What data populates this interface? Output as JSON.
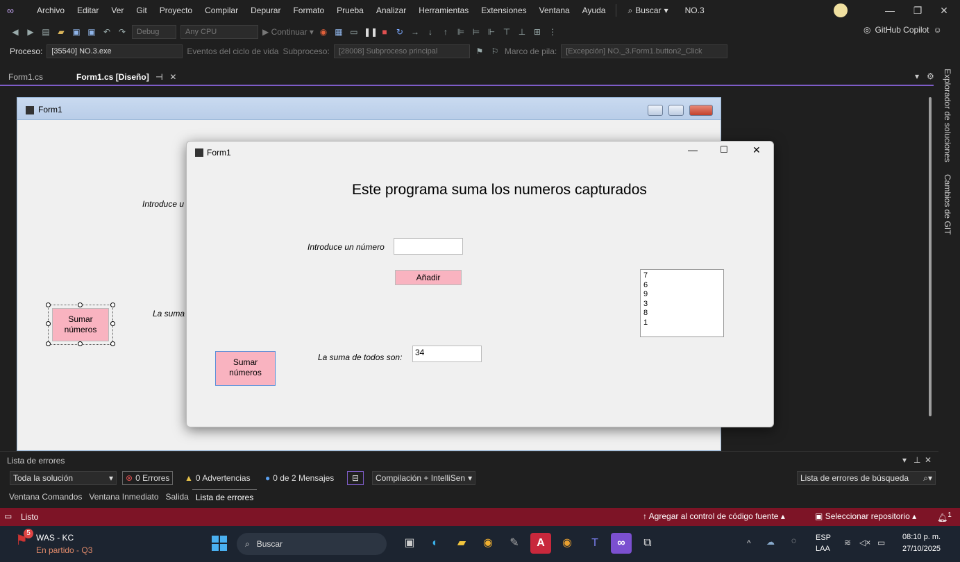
{
  "menubar": {
    "items": [
      "Archivo",
      "Editar",
      "Ver",
      "Git",
      "Proyecto",
      "Compilar",
      "Depurar",
      "Formato",
      "Prueba",
      "Analizar",
      "Herramientas",
      "Extensiones",
      "Ventana",
      "Ayuda"
    ],
    "search_label": "Buscar",
    "solution_name": "NO.3"
  },
  "toolbar": {
    "config": "Debug",
    "platform": "Any CPU",
    "continue_label": "Continuar",
    "copilot_label": "GitHub Copilot"
  },
  "procbar": {
    "process_label": "Proceso:",
    "process_value": "[35540] NO.3.exe",
    "lifecycle_label": "Eventos del ciclo de vida",
    "thread_label": "Subproceso:",
    "thread_value": "[28008] Subproceso principal",
    "stack_label": "Marco de pila:",
    "stack_value": "[Excepción] NO._3.Form1.button2_Click"
  },
  "tabs": [
    {
      "label": "Form1.cs",
      "active": false
    },
    {
      "label": "Form1.cs [Diseño]",
      "active": true
    }
  ],
  "side_tabs": [
    "Explorador de soluciones",
    "Cambios de GIT"
  ],
  "design_form": {
    "title": "Form1",
    "label_intro": "Introduce u",
    "label_sum": "La suma",
    "button_sum": "Sumar números"
  },
  "runtime_form": {
    "title": "Form1",
    "heading": "Este programa suma los numeros capturados",
    "label_intro": "Introduce un número",
    "input_value": "",
    "button_add": "Añadir",
    "label_sum": "La suma de todos son:",
    "sum_value": "34",
    "button_sum": "Sumar números",
    "list_items": [
      "7",
      "6",
      "9",
      "3",
      "8",
      "1"
    ]
  },
  "errlist": {
    "title": "Lista de errores",
    "scope": "Toda la solución",
    "errors": "0 Errores",
    "warnings": "0 Advertencias",
    "messages": "0 de 2 Mensajes",
    "build": "Compilación + IntelliSen",
    "search_placeholder": "Lista de errores de búsqueda",
    "bottom_tabs": [
      "Ventana Comandos",
      "Ventana Inmediato",
      "Salida",
      "Lista de errores"
    ]
  },
  "statusbar": {
    "status": "Listo",
    "add_source": "Agregar al control de código fuente",
    "select_repo": "Seleccionar repositorio",
    "notif_count": "1"
  },
  "taskbar": {
    "weather_title": "WAS - KC",
    "weather_sub": "En partido - Q3",
    "weather_badge": "5",
    "search_label": "Buscar",
    "lang": "ESP",
    "lang_sub": "LAA",
    "time": "08:10 p. m.",
    "date": "27/10/2025"
  }
}
